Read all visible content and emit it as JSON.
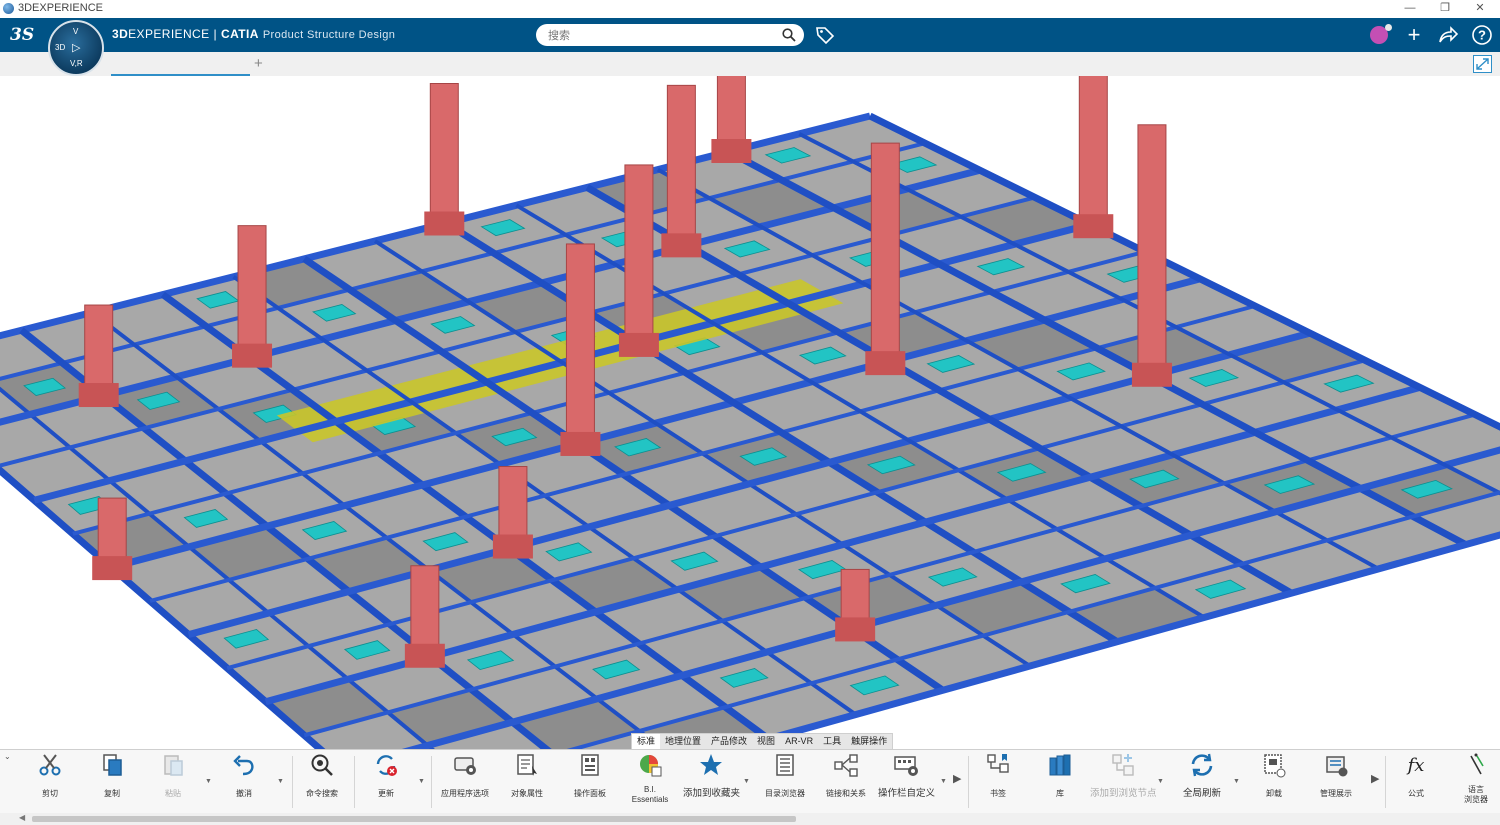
{
  "window": {
    "title": "3DEXPERIENCE",
    "controls": [
      "minimize",
      "restore",
      "close"
    ]
  },
  "header": {
    "brand_bold": "3D",
    "brand_rest": "EXPERIENCE",
    "brand_app": "CATIA",
    "app_name": "Product Structure Design",
    "search_placeholder": "搜索",
    "colors": {
      "bar": "#005386",
      "avatar": "#c44fb4"
    }
  },
  "compass": {
    "top": "V",
    "mid": "3D",
    "bottom": "V,R"
  },
  "tabs": {
    "add_label": "+"
  },
  "section_tabs": [
    "标准",
    "地理位置",
    "产品修改",
    "视图",
    "AR-VR",
    "工具",
    "触屏操作"
  ],
  "section_active": 0,
  "actions": {
    "cut": "剪切",
    "copy": "复制",
    "paste": "粘贴",
    "undo": "撤消",
    "command_search": "命令搜索",
    "update": "更新",
    "app_options": "应用程序选项",
    "object_properties": "对象属性",
    "operation_panel": "操作面板",
    "bi_essentials_1": "B.I.",
    "bi_essentials_2": "Essentials",
    "add_favorites": "添加到收藏夹",
    "catalog_browser": "目录浏览器",
    "links_relations": "链接和关系",
    "customize_toolbar": "操作栏自定义",
    "bookmark": "书签",
    "library": "库",
    "add_browse_node": "添加到浏览节点",
    "global_refresh": "全局刷新",
    "unload": "卸载",
    "manage_display": "管理展示",
    "formula": "公式",
    "language_browser_1": "语言",
    "language_browser_2": "浏览器"
  }
}
